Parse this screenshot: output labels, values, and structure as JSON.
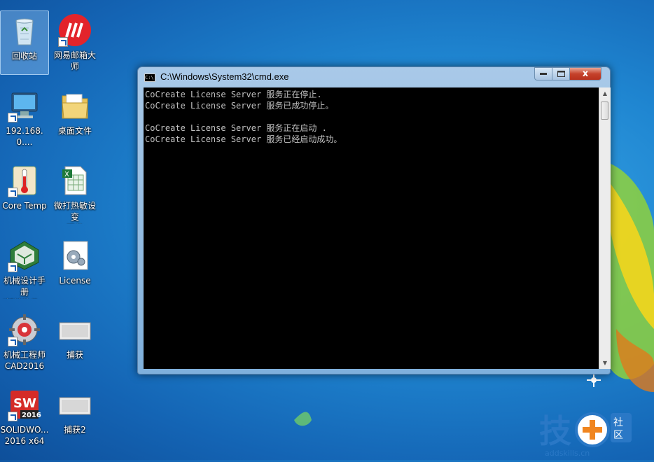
{
  "desktop": {
    "icons": [
      {
        "label": "回收站"
      },
      {
        "label": "网易邮箱大师"
      },
      {
        "label": "192.168.0...."
      },
      {
        "label": "桌面文件"
      },
      {
        "label": "Core Temp"
      },
      {
        "label": "微打热敏设变\n汇总"
      },
      {
        "label": "机械设计手册\n(新编软件..."
      },
      {
        "label": "License"
      },
      {
        "label": "机械工程师\nCAD2016 ..."
      },
      {
        "label": "捕获"
      },
      {
        "label": "SOLIDWO...\n2016 x64 ..."
      },
      {
        "label": "捕获2"
      }
    ]
  },
  "window": {
    "title": "C:\\Windows\\System32\\cmd.exe",
    "icon_text": "C:\\",
    "controls": {
      "close": "x"
    },
    "console_lines": [
      "CoCreate License Server 服务正在停止.",
      "CoCreate License Server 服务已成功停止。",
      "",
      "CoCreate License Server 服务正在启动 .",
      "CoCreate License Server 服务已经启动成功。"
    ]
  },
  "watermark": {
    "text": "技",
    "badge": "社\n区",
    "url": "addskills.cn"
  },
  "colors": {
    "console_bg": "#000000",
    "console_fg": "#c0c0c0",
    "close_red": "#c5422c"
  }
}
